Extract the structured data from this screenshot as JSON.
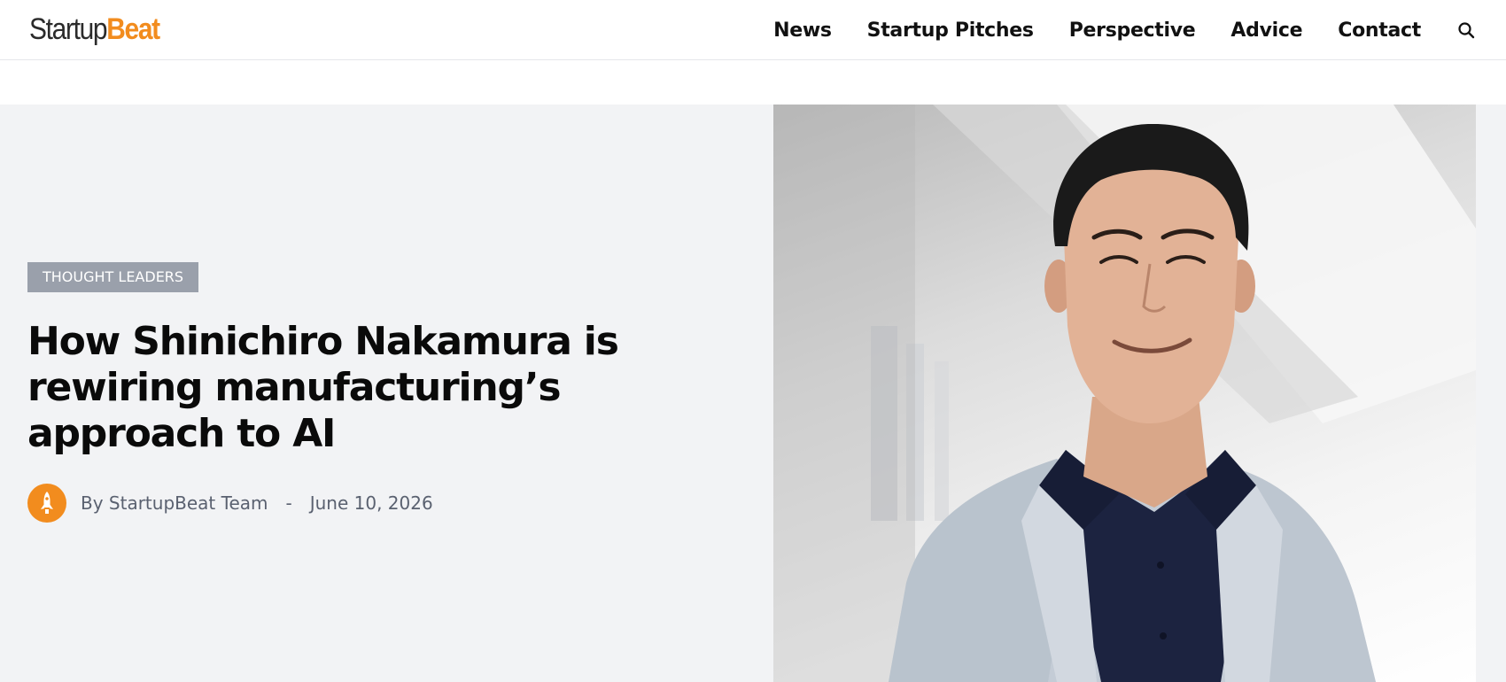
{
  "header": {
    "logo": {
      "part_a": "Startup",
      "part_b": "Beat"
    },
    "nav": [
      {
        "label": "News"
      },
      {
        "label": "Startup Pitches"
      },
      {
        "label": "Perspective"
      },
      {
        "label": "Advice"
      },
      {
        "label": "Contact"
      }
    ],
    "search_icon": "search-icon"
  },
  "hero": {
    "category": "THOUGHT LEADERS",
    "title": "How Shinichiro Nakamura is rewiring manufacturing’s approach to AI",
    "byline": {
      "author": "By StartupBeat Team",
      "separator": "-",
      "date": "June 10, 2026",
      "avatar_icon": "rocket-icon"
    },
    "photo_subject": "portrait-photo"
  },
  "colors": {
    "brand_orange": "#f28c1e",
    "badge_gray": "#9aa0ab",
    "hero_bg": "#f2f3f5",
    "byline_gray": "#5a6170"
  }
}
